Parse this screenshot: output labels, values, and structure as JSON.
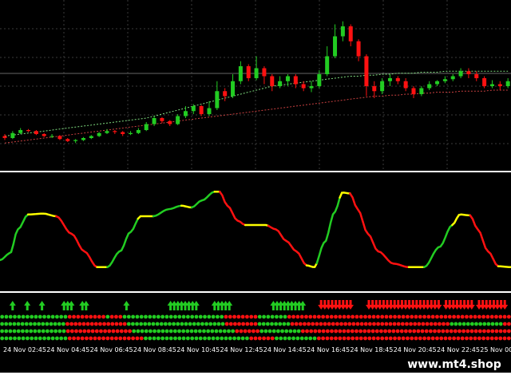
{
  "colors": {
    "background": "#000000",
    "bull": "#22cc22",
    "bear": "#ff1111",
    "neutral": "#ffff00",
    "separator": "#ffffff"
  },
  "main_chart": {
    "candles": [
      [
        1.0,
        0.98,
        1.02,
        0.96
      ],
      [
        0.98,
        1.03,
        1.05,
        0.97
      ],
      [
        1.03,
        1.06,
        1.08,
        1.02
      ],
      [
        1.06,
        1.05,
        1.07,
        1.04
      ],
      [
        1.05,
        1.02,
        1.06,
        1.01
      ],
      [
        1.02,
        1.0,
        1.03,
        0.99
      ],
      [
        1.0,
        1.0,
        1.02,
        0.98
      ],
      [
        1.0,
        0.97,
        1.01,
        0.96
      ],
      [
        0.97,
        0.95,
        0.98,
        0.94
      ],
      [
        0.95,
        0.96,
        0.97,
        0.93
      ],
      [
        0.96,
        0.98,
        0.99,
        0.95
      ],
      [
        0.98,
        1.0,
        1.01,
        0.97
      ],
      [
        1.0,
        1.03,
        1.04,
        0.99
      ],
      [
        1.03,
        1.05,
        1.07,
        1.02
      ],
      [
        1.05,
        1.04,
        1.06,
        1.02
      ],
      [
        1.04,
        1.02,
        1.05,
        1.0
      ],
      [
        1.02,
        1.03,
        1.05,
        1.01
      ],
      [
        1.03,
        1.06,
        1.08,
        1.02
      ],
      [
        1.06,
        1.12,
        1.14,
        1.05
      ],
      [
        1.12,
        1.18,
        1.2,
        1.1
      ],
      [
        1.18,
        1.15,
        1.19,
        1.13
      ],
      [
        1.15,
        1.12,
        1.16,
        1.1
      ],
      [
        1.12,
        1.2,
        1.22,
        1.11
      ],
      [
        1.2,
        1.25,
        1.3,
        1.18
      ],
      [
        1.25,
        1.3,
        1.32,
        1.22
      ],
      [
        1.3,
        1.22,
        1.31,
        1.2
      ],
      [
        1.22,
        1.28,
        1.35,
        1.2
      ],
      [
        1.28,
        1.45,
        1.55,
        1.26
      ],
      [
        1.45,
        1.4,
        1.48,
        1.35
      ],
      [
        1.4,
        1.55,
        1.62,
        1.38
      ],
      [
        1.55,
        1.7,
        1.75,
        1.52
      ],
      [
        1.7,
        1.58,
        1.72,
        1.55
      ],
      [
        1.58,
        1.68,
        1.8,
        1.56
      ],
      [
        1.68,
        1.6,
        1.7,
        1.52
      ],
      [
        1.6,
        1.5,
        1.62,
        1.45
      ],
      [
        1.5,
        1.55,
        1.6,
        1.48
      ],
      [
        1.55,
        1.6,
        1.62,
        1.5
      ],
      [
        1.6,
        1.52,
        1.62,
        1.48
      ],
      [
        1.52,
        1.48,
        1.55,
        1.45
      ],
      [
        1.48,
        1.5,
        1.55,
        1.44
      ],
      [
        1.5,
        1.62,
        1.66,
        1.48
      ],
      [
        1.62,
        1.8,
        1.9,
        1.6
      ],
      [
        1.8,
        2.0,
        2.12,
        1.78
      ],
      [
        2.0,
        2.1,
        2.15,
        1.95
      ],
      [
        2.1,
        1.95,
        2.12,
        1.9
      ],
      [
        1.95,
        1.8,
        1.97,
        1.75
      ],
      [
        1.8,
        1.5,
        1.82,
        1.4
      ],
      [
        1.5,
        1.45,
        1.55,
        1.38
      ],
      [
        1.45,
        1.55,
        1.58,
        1.42
      ],
      [
        1.55,
        1.58,
        1.62,
        1.5
      ],
      [
        1.58,
        1.55,
        1.6,
        1.52
      ],
      [
        1.55,
        1.48,
        1.58,
        1.45
      ],
      [
        1.48,
        1.42,
        1.5,
        1.38
      ],
      [
        1.42,
        1.48,
        1.5,
        1.4
      ],
      [
        1.48,
        1.52,
        1.55,
        1.46
      ],
      [
        1.52,
        1.55,
        1.56,
        1.5
      ],
      [
        1.55,
        1.57,
        1.6,
        1.53
      ],
      [
        1.57,
        1.6,
        1.62,
        1.55
      ],
      [
        1.6,
        1.65,
        1.68,
        1.58
      ],
      [
        1.65,
        1.62,
        1.68,
        1.58
      ],
      [
        1.62,
        1.58,
        1.65,
        1.55
      ],
      [
        1.58,
        1.5,
        1.6,
        1.48
      ],
      [
        1.5,
        1.52,
        1.56,
        1.48
      ],
      [
        1.52,
        1.5,
        1.55,
        1.46
      ],
      [
        1.5,
        1.55,
        1.58,
        1.48
      ]
    ],
    "ma_fast": [
      1.0,
      1.01,
      1.02,
      1.03,
      1.04,
      1.05,
      1.06,
      1.07,
      1.08,
      1.09,
      1.1,
      1.11,
      1.12,
      1.13,
      1.14,
      1.15,
      1.16,
      1.17,
      1.18,
      1.2,
      1.22,
      1.24,
      1.26,
      1.28,
      1.3,
      1.32,
      1.34,
      1.36,
      1.38,
      1.4,
      1.42,
      1.44,
      1.46,
      1.48,
      1.5,
      1.51,
      1.52,
      1.53,
      1.54,
      1.55,
      1.56,
      1.57,
      1.58,
      1.59,
      1.6,
      1.6,
      1.61,
      1.61,
      1.62,
      1.62,
      1.63,
      1.63,
      1.63,
      1.64,
      1.64,
      1.64,
      1.65,
      1.65,
      1.65,
      1.65,
      1.65,
      1.65,
      1.65,
      1.65,
      1.65
    ],
    "ma_slow": [
      0.93,
      0.94,
      0.95,
      0.96,
      0.97,
      0.98,
      0.99,
      1.0,
      1.01,
      1.02,
      1.03,
      1.04,
      1.05,
      1.06,
      1.07,
      1.08,
      1.09,
      1.1,
      1.11,
      1.12,
      1.13,
      1.14,
      1.15,
      1.16,
      1.17,
      1.18,
      1.19,
      1.2,
      1.21,
      1.22,
      1.23,
      1.24,
      1.25,
      1.26,
      1.27,
      1.28,
      1.29,
      1.3,
      1.31,
      1.32,
      1.33,
      1.34,
      1.35,
      1.36,
      1.37,
      1.38,
      1.39,
      1.4,
      1.4,
      1.41,
      1.41,
      1.42,
      1.42,
      1.43,
      1.43,
      1.44,
      1.44,
      1.44,
      1.45,
      1.45,
      1.45,
      1.45,
      1.46,
      1.46,
      1.46
    ],
    "yrange": [
      0.7,
      2.3
    ]
  },
  "oscillator": {
    "points": [
      [
        0,
        0.1
      ],
      [
        0.02,
        0.18
      ],
      [
        0.035,
        0.45
      ],
      [
        0.055,
        0.62
      ],
      [
        0.085,
        0.63
      ],
      [
        0.11,
        0.6
      ],
      [
        0.14,
        0.4
      ],
      [
        0.165,
        0.2
      ],
      [
        0.19,
        0.02
      ],
      [
        0.21,
        0.02
      ],
      [
        0.235,
        0.2
      ],
      [
        0.255,
        0.42
      ],
      [
        0.275,
        0.6
      ],
      [
        0.3,
        0.6
      ],
      [
        0.33,
        0.68
      ],
      [
        0.355,
        0.72
      ],
      [
        0.375,
        0.7
      ],
      [
        0.395,
        0.78
      ],
      [
        0.42,
        0.88
      ],
      [
        0.43,
        0.88
      ],
      [
        0.445,
        0.72
      ],
      [
        0.465,
        0.55
      ],
      [
        0.48,
        0.5
      ],
      [
        0.52,
        0.5
      ],
      [
        0.54,
        0.45
      ],
      [
        0.56,
        0.32
      ],
      [
        0.58,
        0.2
      ],
      [
        0.6,
        0.04
      ],
      [
        0.615,
        0.02
      ],
      [
        0.635,
        0.3
      ],
      [
        0.655,
        0.65
      ],
      [
        0.67,
        0.87
      ],
      [
        0.685,
        0.86
      ],
      [
        0.7,
        0.68
      ],
      [
        0.72,
        0.4
      ],
      [
        0.74,
        0.2
      ],
      [
        0.77,
        0.06
      ],
      [
        0.8,
        0.02
      ],
      [
        0.83,
        0.02
      ],
      [
        0.86,
        0.25
      ],
      [
        0.885,
        0.5
      ],
      [
        0.9,
        0.62
      ],
      [
        0.92,
        0.61
      ],
      [
        0.935,
        0.45
      ],
      [
        0.955,
        0.2
      ],
      [
        0.975,
        0.03
      ],
      [
        1.0,
        0.02
      ]
    ],
    "segments": [
      [
        0,
        0.035,
        "bull"
      ],
      [
        0.035,
        0.055,
        "bull"
      ],
      [
        0.055,
        0.11,
        "neutral"
      ],
      [
        0.11,
        0.19,
        "bear"
      ],
      [
        0.19,
        0.21,
        "neutral"
      ],
      [
        0.21,
        0.27,
        "bull"
      ],
      [
        0.27,
        0.3,
        "neutral"
      ],
      [
        0.3,
        0.355,
        "bull"
      ],
      [
        0.355,
        0.375,
        "neutral"
      ],
      [
        0.375,
        0.42,
        "bull"
      ],
      [
        0.42,
        0.43,
        "neutral"
      ],
      [
        0.43,
        0.48,
        "bear"
      ],
      [
        0.48,
        0.525,
        "neutral"
      ],
      [
        0.525,
        0.6,
        "bear"
      ],
      [
        0.6,
        0.62,
        "neutral"
      ],
      [
        0.62,
        0.665,
        "bull"
      ],
      [
        0.665,
        0.685,
        "neutral"
      ],
      [
        0.685,
        0.8,
        "bear"
      ],
      [
        0.8,
        0.83,
        "neutral"
      ],
      [
        0.83,
        0.885,
        "bull"
      ],
      [
        0.885,
        0.92,
        "neutral"
      ],
      [
        0.92,
        0.975,
        "bear"
      ],
      [
        0.975,
        1.0,
        "neutral"
      ]
    ]
  },
  "signals": {
    "up_arrows": [
      3,
      7,
      11,
      17,
      18,
      19,
      22,
      23,
      34,
      46,
      47,
      48,
      49,
      50,
      51,
      52,
      53,
      58,
      59,
      60,
      61,
      62,
      74,
      75,
      76,
      77,
      78,
      79,
      80,
      81,
      82
    ],
    "down_arrows": [
      87,
      88,
      89,
      90,
      91,
      92,
      93,
      94,
      95,
      100,
      101,
      102,
      103,
      104,
      105,
      106,
      107,
      108,
      109,
      110,
      111,
      112,
      113,
      114,
      115,
      116,
      117,
      118,
      119,
      121,
      122,
      123,
      124,
      125,
      126,
      127,
      128,
      130,
      131,
      132,
      133,
      134,
      135,
      136,
      137,
      155,
      156,
      157,
      158,
      159,
      160,
      168,
      169,
      170,
      171,
      172,
      173,
      174
    ],
    "rows": [
      "GGGGGGGGGGGGGGGGRRRRRRRRRGRRRGGGGGGGGGGGGGGGGGGGGGGGGRRRRRRRRGGGGGGGRRRRRRRRRRRRRRRRRRRRRRRRRRRRRRRRRRRRRRRRRRRRRRRRRRRRR",
      "GGGGGGGGGGGGGGGGRRRRRRRRRRRRRRRGGGGGGGGGGGGGGGGGGGGGGGGRRRRRRRRGGGGGGGGRRRRRRRRRRRRRRRRRRRRRRRRRRRRRRRRRRRRRRRGGGGGGGGGGGGGRR",
      "GGGGGGGGGGGGGGGGRRRRRRRRRRRRRRRRGGGGGGGGGGGGGGGGGGGGGGGGGRRRRRRGGGGGGGGGGRRRRRRRRRRRRRRRRRRRRRRRRRRRRRRRRRRRRRRRRRRRRRRRRRRR",
      "GGGGGGGGGGGGGGGGRRRRRRRRRRRRRRRRRRGGGGGGGGGGGGGGGGGGGGGGGGGRRRRRRGGGGGGGGGGRRRRRRRRRRRRRRRRRRRRRRRRRRRRRRRRRRRRRRRRRRRRRR"
    ]
  },
  "time_axis": {
    "labels": [
      "24 Nov 02:45",
      "24 Nov 04:45",
      "24 Nov 06:45",
      "24 Nov 08:45",
      "24 Nov 10:45",
      "24 Nov 12:45",
      "24 Nov 14:45",
      "24 Nov 16:45",
      "24 Nov 18:45",
      "24 Nov 20:45",
      "24 Nov 22:45",
      "25 Nov 00"
    ]
  },
  "watermark": "www.mt4.shop"
}
